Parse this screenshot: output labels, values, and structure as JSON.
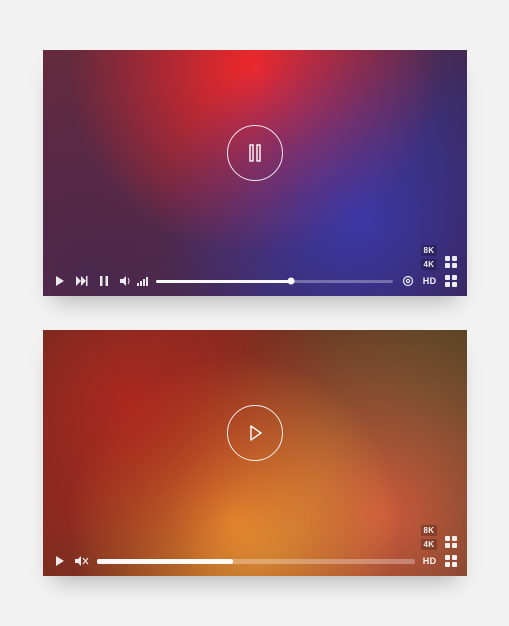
{
  "players": [
    {
      "state": "playing",
      "progress_pct": 57,
      "quality_options": [
        "8K",
        "4K"
      ],
      "current_quality": "HD",
      "controls": {
        "has_next": true,
        "has_pause": true,
        "has_settings": true,
        "vol_muted": false
      }
    },
    {
      "state": "paused",
      "progress_pct": 43,
      "quality_options": [
        "8K",
        "4K"
      ],
      "current_quality": "HD",
      "controls": {
        "has_next": false,
        "has_pause": false,
        "has_settings": false,
        "vol_muted": true
      }
    }
  ]
}
